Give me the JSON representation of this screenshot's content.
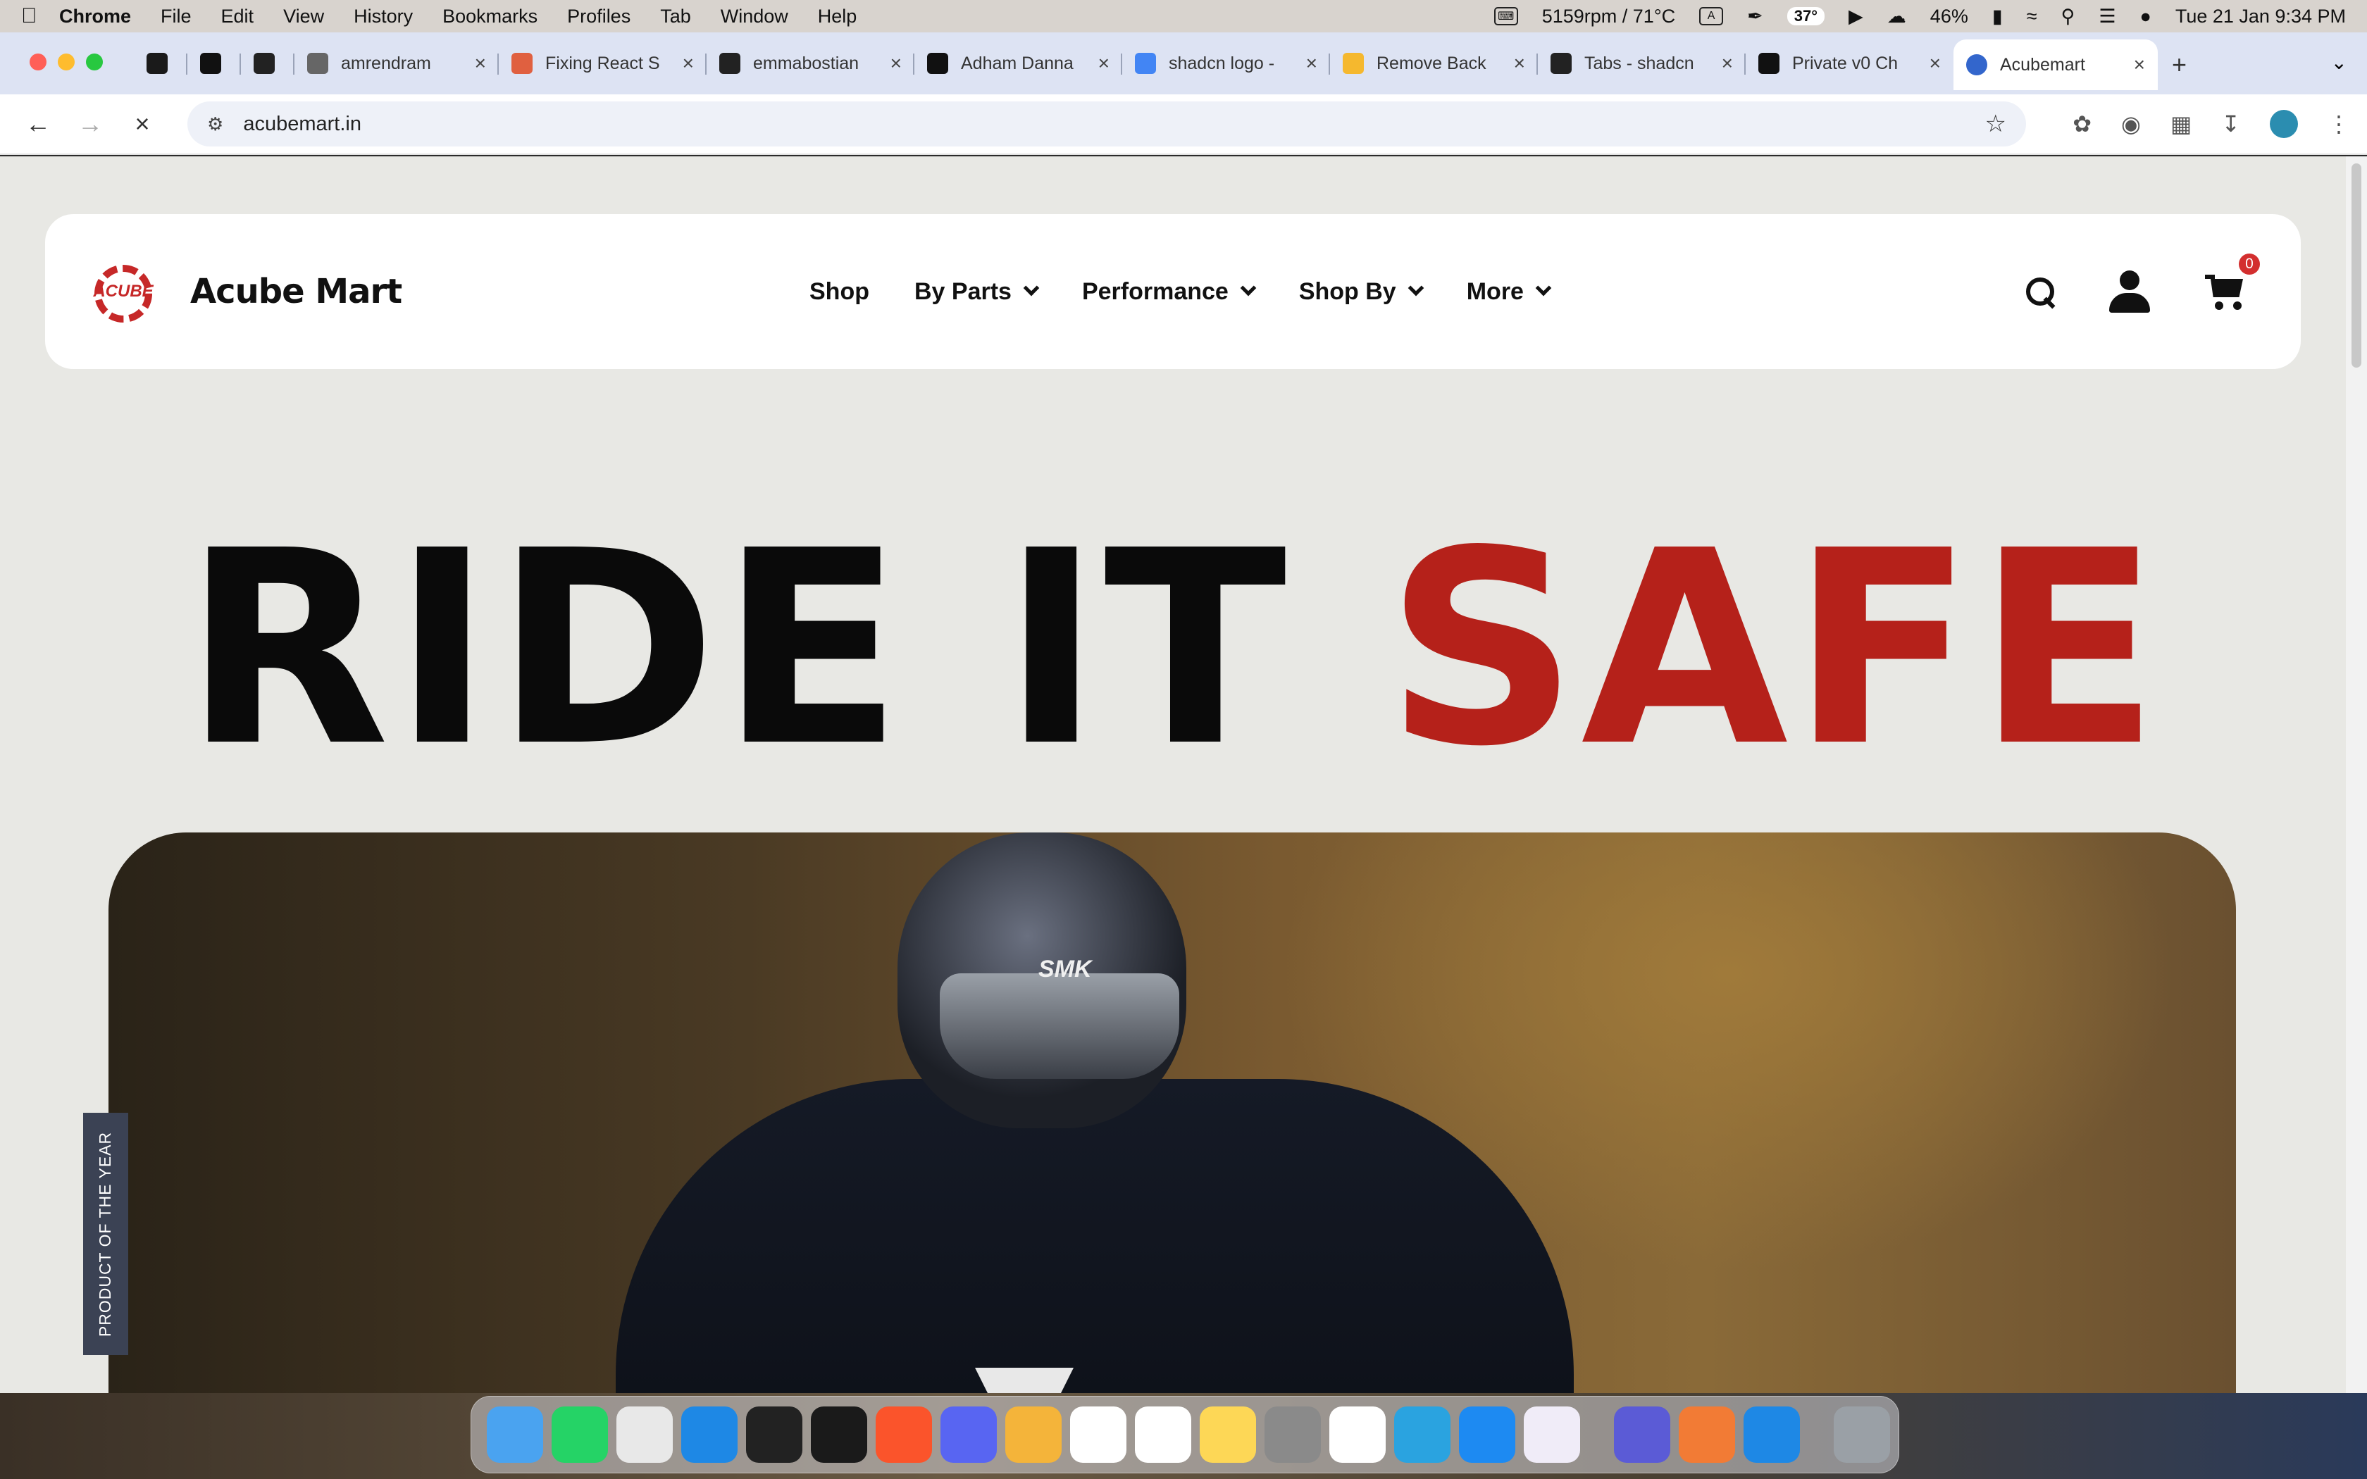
{
  "menubar": {
    "app": "Chrome",
    "items": [
      "File",
      "Edit",
      "View",
      "History",
      "Bookmarks",
      "Profiles",
      "Tab",
      "Window",
      "Help"
    ],
    "fan": "5159rpm / 71°C",
    "input_source": "A",
    "temperature": "37°",
    "battery": "46%",
    "datetime": "Tue 21 Jan  9:34 PM"
  },
  "tabs": [
    {
      "title": "",
      "color": "#1a1a1a"
    },
    {
      "title": "",
      "color": "#111111"
    },
    {
      "title": "",
      "color": "#222222"
    },
    {
      "title": "amrendram",
      "color": "#666666"
    },
    {
      "title": "Fixing React S",
      "color": "#e06040"
    },
    {
      "title": "emmabostian",
      "color": "#222222"
    },
    {
      "title": "Adham Danna",
      "color": "#111111"
    },
    {
      "title": "shadcn logo -",
      "color": "#4285f4"
    },
    {
      "title": "Remove Back",
      "color": "#f5b82e"
    },
    {
      "title": "Tabs - shadcn",
      "color": "#222222"
    },
    {
      "title": "Private v0 Ch",
      "color": "#111111"
    },
    {
      "title": "Acubemart",
      "color": "#3366cc"
    }
  ],
  "address": {
    "url": "acubemart.in"
  },
  "site": {
    "brand": "Acube Mart",
    "logo_text": "ACUBE",
    "nav": {
      "shop": "Shop",
      "by_parts": "By Parts",
      "performance": "Performance",
      "shop_by": "Shop By",
      "more": "More"
    },
    "cart_count": "0",
    "hero_part1": "RIDE IT ",
    "hero_part2": "SAFE",
    "side_label": "PRODUCT OF THE YEAR",
    "helmet_brand": "SMK"
  },
  "colors": {
    "accent": "#b5211a",
    "badge": "#d32f2f",
    "side_label_bg": "#3b4254"
  },
  "dock": [
    {
      "name": "Finder",
      "color": "#4aa3f0"
    },
    {
      "name": "WhatsApp",
      "color": "#25d366"
    },
    {
      "name": "Chrome",
      "color": "#e8e8e8"
    },
    {
      "name": "VS Code",
      "color": "#1e88e5"
    },
    {
      "name": "Cube",
      "color": "#222222"
    },
    {
      "name": "Terminal",
      "color": "#1a1a1a"
    },
    {
      "name": "Brave",
      "color": "#fb542b"
    },
    {
      "name": "Discord",
      "color": "#5865f2"
    },
    {
      "name": "Sequel",
      "color": "#f4b43a"
    },
    {
      "name": "Calendar",
      "color": "#ffffff"
    },
    {
      "name": "Reminders",
      "color": "#ffffff"
    },
    {
      "name": "Notes",
      "color": "#fdd756"
    },
    {
      "name": "System Settings",
      "color": "#8a8a8a"
    },
    {
      "name": "Freeform",
      "color": "#ffffff"
    },
    {
      "name": "Telegram",
      "color": "#2aa3e0"
    },
    {
      "name": "App Store",
      "color": "#1d8af2"
    },
    {
      "name": "Arc",
      "color": "#f0ecf8"
    },
    {
      "name": "Linear",
      "color": "#5b5bd6"
    },
    {
      "name": "Pencil",
      "color": "#f27b35"
    },
    {
      "name": "VS Code Insiders",
      "color": "#1e88e5"
    },
    {
      "name": "Trash",
      "color": "#9aa0a6"
    }
  ]
}
